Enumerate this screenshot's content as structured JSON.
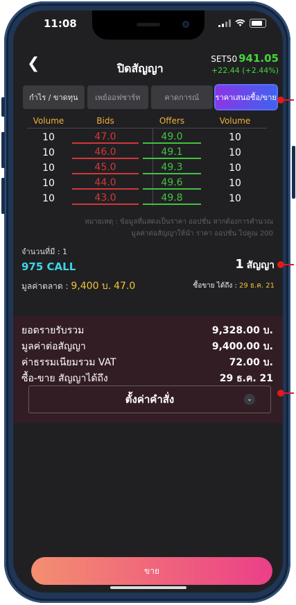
{
  "status": {
    "time": "11:08"
  },
  "header": {
    "title": "ปิดสัญญา",
    "index_name": "SET50",
    "index_value": "941.05",
    "index_change": "+22.44 (+2.44%)"
  },
  "tabs": [
    {
      "label": "กำไร / ขาดทุน"
    },
    {
      "label": "เพย์ออฟชาร์ท"
    },
    {
      "label": "คาดการณ์"
    },
    {
      "label": "ราคาเสนอซื้อ/ขาย"
    }
  ],
  "orderbook": {
    "headers": [
      "Volume",
      "Bids",
      "Offers",
      "Volume"
    ],
    "rows": [
      {
        "bid_vol": "10",
        "bid": "47.0",
        "offer": "49.0",
        "offer_vol": "10"
      },
      {
        "bid_vol": "10",
        "bid": "46.0",
        "offer": "49.1",
        "offer_vol": "10"
      },
      {
        "bid_vol": "10",
        "bid": "45.0",
        "offer": "49.3",
        "offer_vol": "10"
      },
      {
        "bid_vol": "10",
        "bid": "44.0",
        "offer": "49.6",
        "offer_vol": "10"
      },
      {
        "bid_vol": "10",
        "bid": "43.0",
        "offer": "49.8",
        "offer_vol": "10"
      }
    ],
    "note_line1": "หมายเหตุ : ข้อมูลที่แสดงเป็นราคา ออปชั่น หากต้องการคำนวณ",
    "note_line2": "มูลค่าต่อสัญญาให้นำ ราคา ออปชั่น ไปคูณ 200"
  },
  "position": {
    "available_label": "จำนวนที่มี : 1",
    "series": "975 CALL",
    "contracts_value": "1",
    "contracts_unit": "สัญญา",
    "market_value_label": "มูลค่าตลาด :",
    "market_value": "9,400 บ.",
    "market_price": "47.0",
    "trade_until_label": "ซื้อขาย ได้ถึง :",
    "trade_until": "29 ธ.ค. 21"
  },
  "summary": {
    "rows": [
      {
        "label": "ยอดรายรับรวม",
        "value": "9,328.00 บ."
      },
      {
        "label": "มูลค่าต่อสัญญา",
        "value": "9,400.00 บ."
      },
      {
        "label": "ค่าธรรมเนียมรวม VAT",
        "value": "72.00 บ."
      },
      {
        "label": "ซื้อ-ขาย สัญญาได้ถึง",
        "value": "29 ธ.ค. 21"
      }
    ],
    "settings_label": "ตั้งค่าคำสั่ง"
  },
  "actions": {
    "sell_label": "ขาย"
  },
  "colors": {
    "callout": "#e21a1a",
    "bid": "#d23838",
    "offer": "#43c33f",
    "accent_gain": "#43d63a"
  }
}
